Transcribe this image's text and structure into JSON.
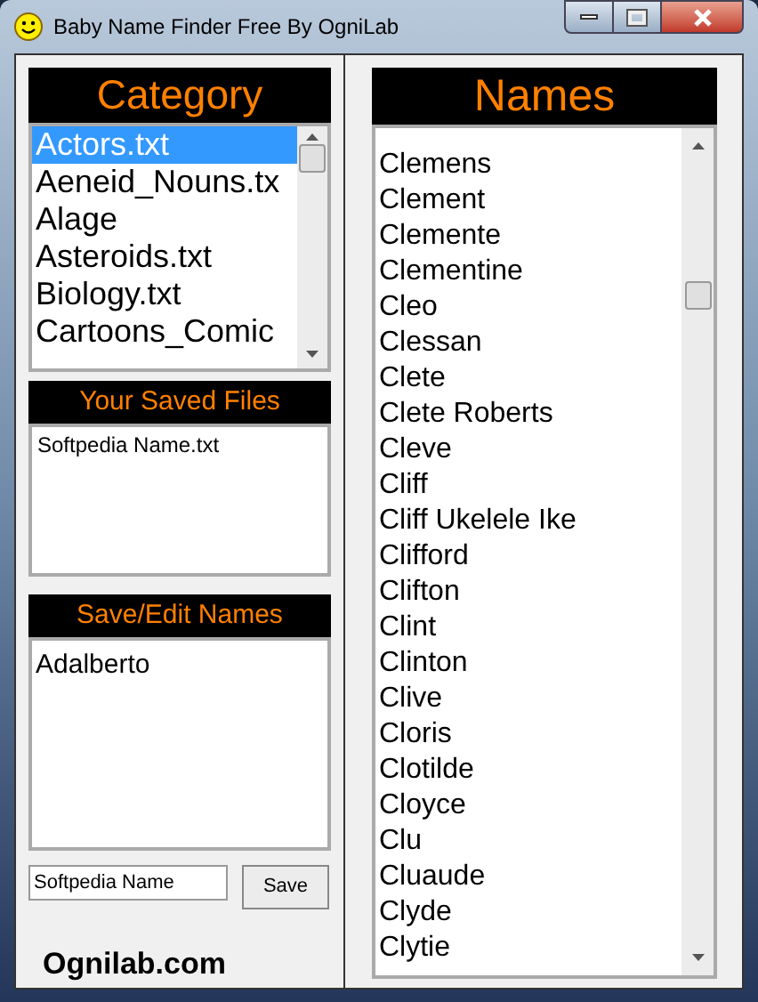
{
  "window": {
    "title": "Baby Name Finder Free By OgniLab"
  },
  "category": {
    "title": "Category",
    "items": [
      {
        "label": "Actors.txt",
        "selected": true
      },
      {
        "label": "Aeneid_Nouns.tx",
        "selected": false
      },
      {
        "label": "Alage",
        "selected": false
      },
      {
        "label": "Asteroids.txt",
        "selected": false
      },
      {
        "label": "Biology.txt",
        "selected": false
      },
      {
        "label": "Cartoons_Comic",
        "selected": false
      }
    ]
  },
  "saved_files": {
    "title": "Your Saved Files",
    "items": [
      "Softpedia Name.txt"
    ]
  },
  "save_edit": {
    "title": "Save/Edit Names",
    "text": "Adalberto"
  },
  "file_name_field": {
    "value": "Softpedia Name"
  },
  "save_button": "Save",
  "footer_link": "Ognilab.com",
  "names": {
    "title": "Names",
    "items": [
      "Clemens",
      "Clement",
      "Clemente",
      "Clementine",
      "Cleo",
      "Clessan",
      "Clete",
      "Clete Roberts",
      "Cleve",
      "Cliff",
      "Cliff Ukelele Ike",
      "Clifford",
      "Clifton",
      "Clint",
      "Clinton",
      "Clive",
      "Cloris",
      "Clotilde",
      "Cloyce",
      "Clu",
      "Cluaude",
      "Clyde",
      "Clytie"
    ]
  }
}
